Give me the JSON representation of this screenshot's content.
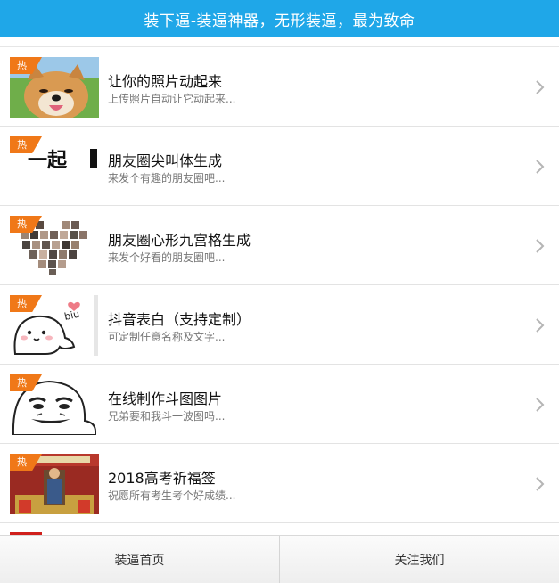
{
  "header": {
    "title": "装下逼-装逼神器，无形装逼，最为致命"
  },
  "hot_badge_label": "热",
  "items": [
    {
      "title": "让你的照片动起来",
      "desc": "上传照片自动让它动起来...",
      "thumb_icon": "smiling-shiba-dog-photo"
    },
    {
      "title": "朋友圈尖叫体生成",
      "desc": "来发个有趣的朋友圈吧...",
      "thumb_icon": "bold-text-image",
      "thumb_text": "一起"
    },
    {
      "title": "朋友圈心形九宫格生成",
      "desc": "来发个好看的朋友圈吧...",
      "thumb_icon": "heart-photo-grid"
    },
    {
      "title": "抖音表白（支持定制）",
      "desc": "可定制任意名称及文字...",
      "thumb_icon": "cartoon-blowing-heart",
      "thumb_text": "biu"
    },
    {
      "title": "在线制作斗图图片",
      "desc": "兄弟要和我斗一波图吗...",
      "thumb_icon": "meme-face"
    },
    {
      "title": "2018高考祈福签",
      "desc": "祝愿所有考生考个好成绩...",
      "thumb_icon": "confucius-temple-photo"
    }
  ],
  "bottom_nav": [
    {
      "label": "装逼首页"
    },
    {
      "label": "关注我们"
    }
  ],
  "colors": {
    "header_bg": "#1fa7e8",
    "hot_badge": "#f07818",
    "accent_red": "#d0201c"
  }
}
